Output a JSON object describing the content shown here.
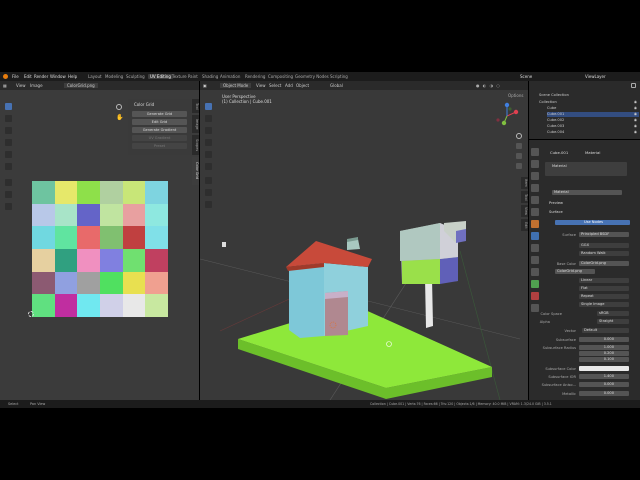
{
  "topbar": {
    "menus": [
      "File",
      "Edit",
      "Render",
      "Window",
      "Help"
    ],
    "tabs": [
      "Layout",
      "Modeling",
      "Sculpting",
      "UV Editing",
      "Texture Paint",
      "Shading",
      "Animation",
      "Rendering",
      "Compositing",
      "Geometry Nodes",
      "Scripting"
    ],
    "active_tab": "UV Editing",
    "scene": "Scene",
    "view_layer": "ViewLayer"
  },
  "uv_editor": {
    "header": [
      "View",
      "Image"
    ],
    "image_name": "ColorGrid.png",
    "panel_title": "Color Grid",
    "buttons": [
      "Generate Grid",
      "Edit Grid",
      "Generate Gradient",
      "UV Gradient",
      "Preset"
    ],
    "side_tabs": [
      "Tool",
      "Image",
      "Scopes",
      "Color Grid"
    ],
    "grid_colors": [
      [
        "#6ec4a0",
        "#e6e86a",
        "#8ee04a",
        "#b0d0a0",
        "#c8e678",
        "#7ed4e0"
      ],
      [
        "#b8c8e8",
        "#a8e4c8",
        "#6464c8",
        "#c0e4a0",
        "#e8a0a0",
        "#8ee8e0"
      ],
      [
        "#70d8e0",
        "#60e4a0",
        "#e86a6a",
        "#80c070",
        "#c04040",
        "#80e0e8"
      ],
      [
        "#e6d0a0",
        "#30a080",
        "#f090c0",
        "#8080e0",
        "#70e070",
        "#c04060"
      ],
      [
        "#8c5a72",
        "#90a0e0",
        "#a0a0a0",
        "#50e060",
        "#e8e050",
        "#f0a090"
      ],
      [
        "#60e080",
        "#c02ea0",
        "#70e8f0",
        "#d0d0e8",
        "#e8e8e8",
        "#c8e8a0"
      ]
    ]
  },
  "viewport": {
    "mode": "Object Mode",
    "menus": [
      "View",
      "Select",
      "Add",
      "Object"
    ],
    "transform": "Global",
    "perspective": "User Perspective",
    "collection_info": "(1) Collection | Cube.001",
    "side_tabs": [
      "Item",
      "Tool",
      "View",
      "Edit"
    ],
    "options_label": "Options"
  },
  "outliner": {
    "title": "Scene Collection",
    "rows": [
      {
        "label": "Collection",
        "indent": 0,
        "selected": false
      },
      {
        "label": "Cube",
        "indent": 1,
        "selected": false
      },
      {
        "label": "Cube.001",
        "indent": 1,
        "selected": true
      },
      {
        "label": "Cube.002",
        "indent": 1,
        "selected": false
      },
      {
        "label": "Cube.003",
        "indent": 1,
        "selected": false
      },
      {
        "label": "Cube.004",
        "indent": 1,
        "selected": false
      }
    ]
  },
  "properties": {
    "object": "Cube.001",
    "tab": "Material",
    "material_slot": "Material",
    "material_name": "Material",
    "preview": "Preview",
    "surface_section": "Surface",
    "use_nodes": "Use Nodes",
    "surface_label": "Surface",
    "surface_value": "Principled BSDF",
    "dist_1": "GGX",
    "dist_2": "Random Walk",
    "base_color_label": "Base Color",
    "base_color_value": "ColorGrid.png",
    "image_name": "ColorGrid.png",
    "interp": "Linear",
    "proj": "Flat",
    "ext": "Repeat",
    "source": "Single Image",
    "color_space_label": "Color Space",
    "color_space": "sRGB",
    "alpha_label": "Alpha",
    "alpha": "Straight",
    "vector_label": "Vector",
    "vector": "Default",
    "subsurface_label": "Subsurface",
    "subsurface": "0.000",
    "radius_label": "Subsurface Radius",
    "radius": [
      "1.000",
      "0.200",
      "0.100"
    ],
    "ss_color_label": "Subsurface Color",
    "ss_ior_label": "Subsurface IOR",
    "ss_ior": "1.400",
    "ss_aniso_label": "Subsurface Aniso...",
    "ss_aniso": "0.000",
    "metallic_label": "Metallic",
    "metallic": "0.000"
  },
  "statusbar": {
    "left": [
      "Select",
      "Pan View",
      "Context Menu"
    ],
    "right": "Collection | Cube.001 | Verts:76 | Faces:66 | Tris:120 | Objects:1/6 | Memory: 40.0 MiB | VRAM: 1.3/24.0 GiB | 3.5.1"
  },
  "colors": {
    "accent": "#4772b3",
    "ground": "#8ee83a",
    "roof": "#c84a3a",
    "walls": "#7ec8d8"
  }
}
